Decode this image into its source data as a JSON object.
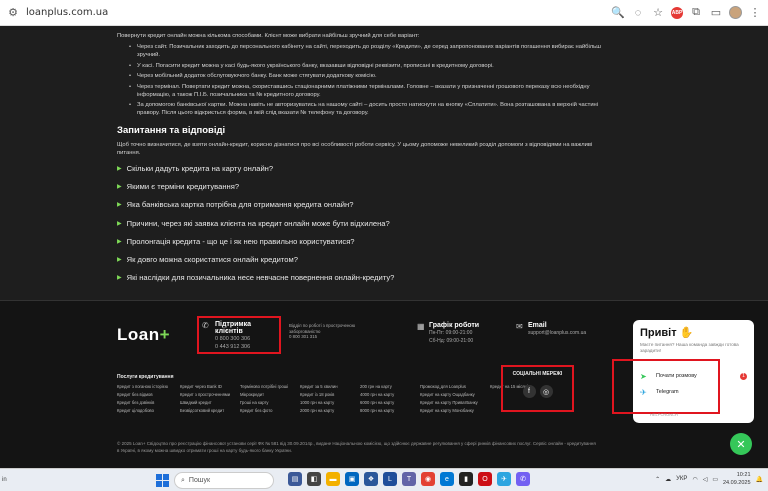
{
  "browser": {
    "url": "loanplus.com.ua",
    "ext_label": "ABP"
  },
  "article": {
    "intro": "Повернути кредит онлайн можна кількома способами. Клієнт може вибрати найбільш зручний для себе варіант:",
    "methods": [
      "Через сайт. Позичальник заходить до персонального кабінету на сайті, переходить до розділу «Кредити», де серед запропонованих варіантів погашення вибирає найбільш зручний.",
      "У касі. Погасити кредит можна у касі будь-якого українського банку, вказавши відповідні реквізити, прописані в кредитному договорі.",
      "Через мобільний додаток обслуговуючого банку. Банк може стягувати додаткову комісію.",
      "Через термінал. Повертати кредит можна, скориставшись стаціонарними платіжними терміналами. Головне – вказати у призначенні грошового переказу всю необхідну інформацію, а також П.І.Б. позичальника та № кредитного договору.",
      "За допомогою банківської картки. Можна навіть не авторизуватись на нашому сайті – досить просто натиснути на кнопку «Сплатити». Вона розташована в верхній частині правору. Після цього відкриється форма, в якій слід вказати № телефону та договору."
    ],
    "faq_title": "Запитання та відповіді",
    "faq_intro": "Щоб точно визначитися, де взяти онлайн-кредит, корисно дізнатися про всі особливості роботи сервісу. У цьому допоможе невеликий розділ допомоги з відповідями на важливі питання.",
    "faq": [
      "Скільки дадуть кредита на карту онлайн?",
      "Якими є терміни кредитування?",
      "Яка банківська картка потрібна для отримання кредита онлайн?",
      "Причини, через які заявка клієнта на кредит онлайн може бути відхилена?",
      "Пролонгація кредита - що це і як нею правильно користуватися?",
      "Як довго можна скористатися онлайн кредитом?",
      "Які наслідки для позичальника несе невчасне повернення онлайн-кредиту?"
    ]
  },
  "footer": {
    "logo": "Loan",
    "logo_plus": "+",
    "support_title": "Підтримка клієнтів",
    "support_phones": [
      "0 800 300 306",
      "0 443 912 306"
    ],
    "note": "Відділ по роботі з простроченою заборгованістю",
    "note_phone": "0 800 301 315",
    "schedule_title": "Графік роботи",
    "schedule": [
      "Пн-Пт: 09:00-21:00",
      "Сб-Нд: 09:00-21:00"
    ],
    "email_title": "Email",
    "email": "support@loanplus.com.ua",
    "services_title": "Послуги кредитування",
    "services": [
      "Кредит з поганою історією",
      "Кредит через Bank ID",
      "Терміново потрібні гроші",
      "Кредит за 5 хвилин",
      "200 грн на карту",
      "Промокод для Loanplus",
      "Кредит на 15 місяців",
      "Кредит без відмов",
      "Кредит з простроченнями",
      "Мікрокредит",
      "Кредит із 18 років",
      "4000 грн на карту",
      "Кредит на карту Ощадбанку",
      "",
      "Кредит без дзвінків",
      "Швидкий кредит",
      "Гроші на карту",
      "1000 грн на карту",
      "6000 грн на карту",
      "Кредит на карту ПриватБанку",
      "",
      "Кредит цілодобово",
      "Безвідсотковий кредит",
      "Кредит без фото",
      "2000 грн на карту",
      "8000 грн на карту",
      "Кредит на карту Монобанку",
      ""
    ],
    "social_title": "СОЦІАЛЬНІ МЕРЕЖІ",
    "social_icons": [
      "f",
      "◎"
    ],
    "copyright": "© 2025 Loan+ Свідоцтво про реєстрацію фінансової установи серії ФК № 581 від 30.09.2014р., видане Національною комісією, що здійснює державне регулювання у сфері ринків фінансових послуг. Сервіс онлайн - кредитування в Україні, в якому можна швидко отримати гроші на карту будь-якого банку України."
  },
  "chat": {
    "title": "Привіт",
    "emoji": "✋",
    "subtitle": "Маєте питання? Наша команда завжди готова зарадити!",
    "options": [
      "Почати розмову",
      "Telegram"
    ],
    "badge": "1",
    "footer": "HELPCRUNCH"
  },
  "taskbar": {
    "left": "in",
    "search": "Пошук",
    "lang": "УКР",
    "time": "10:21",
    "date": "24.09.2025",
    "badge": "2"
  }
}
